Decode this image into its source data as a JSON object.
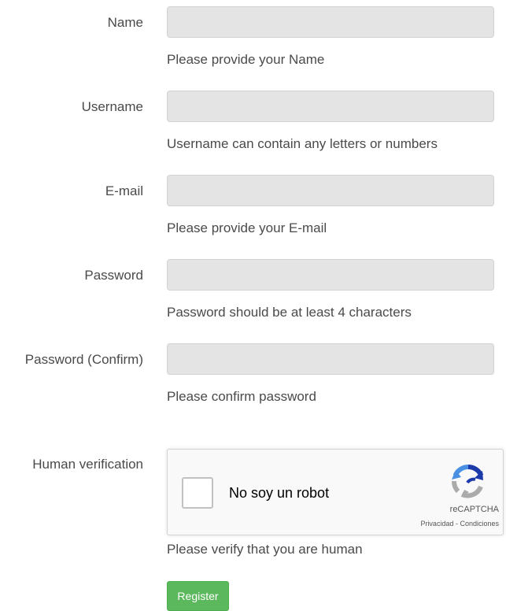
{
  "form": {
    "fields": [
      {
        "label": "Name",
        "value": "",
        "help": "Please provide your Name"
      },
      {
        "label": "Username",
        "value": "",
        "help": "Username can contain any letters or numbers"
      },
      {
        "label": "E-mail",
        "value": "",
        "help": "Please provide your E-mail"
      },
      {
        "label": "Password",
        "value": "",
        "help": "Password should be at least 4 characters"
      },
      {
        "label": "Password (Confirm)",
        "value": "",
        "help": "Please confirm password"
      }
    ],
    "verification": {
      "label": "Human verification",
      "checkbox_text": "No soy un robot",
      "brand": "reCAPTCHA",
      "privacy_link": "Privacidad",
      "separator": " - ",
      "terms_link": "Condiciones",
      "help": "Please verify that you are human",
      "logo_icon": "recaptcha-logo-icon",
      "checked": false
    },
    "submit_label": "Register",
    "colors": {
      "submit_bg": "#5cb85c",
      "input_bg": "#e4e4e4",
      "recaptcha_blue": "#4a90e2",
      "recaptcha_dark_blue": "#1c3aa9",
      "recaptcha_gray": "#ababab"
    }
  }
}
